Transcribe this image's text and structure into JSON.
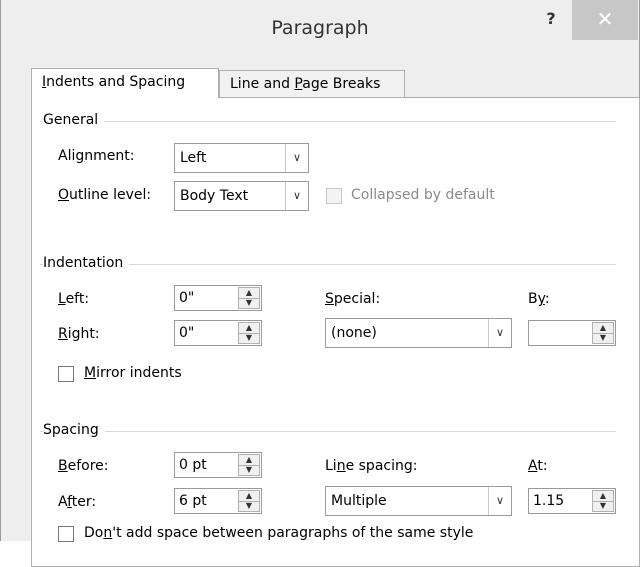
{
  "window": {
    "title": "Paragraph",
    "help_label": "?",
    "close_label": "✕"
  },
  "tabs": [
    {
      "label": "Indents and Spacing",
      "mnemonic": "I",
      "rest": "ndents and Spacing"
    },
    {
      "label": "Line and Page Breaks",
      "pre": "Line and ",
      "mnemonic": "P",
      "rest": "age Breaks"
    }
  ],
  "general": {
    "title": "General",
    "alignment_label": {
      "pre": "Ali",
      "mnemonic": "g",
      "rest": "nment:"
    },
    "alignment_value": "Left",
    "outline_label": {
      "mnemonic": "O",
      "rest": "utline level:"
    },
    "outline_value": "Body Text",
    "collapsed_label": "Collapsed by default"
  },
  "indentation": {
    "title": "Indentation",
    "left_label": {
      "mnemonic": "L",
      "rest": "eft:"
    },
    "left_value": "0\"",
    "right_label": {
      "mnemonic": "R",
      "rest": "ight:"
    },
    "right_value": "0\"",
    "special_label": {
      "mnemonic": "S",
      "rest": "pecial:"
    },
    "special_value": "(none)",
    "by_label": {
      "pre": "B",
      "mnemonic": "y",
      "rest": ":"
    },
    "by_value": "",
    "mirror_label": {
      "mnemonic": "M",
      "rest": "irror indents"
    }
  },
  "spacing": {
    "title": "Spacing",
    "before_label": {
      "mnemonic": "B",
      "rest": "efore:"
    },
    "before_value": "0 pt",
    "after_label": {
      "pre": "A",
      "mnemonic": "f",
      "rest": "ter:"
    },
    "after_value": "6 pt",
    "line_spacing_label": {
      "pre": "Li",
      "mnemonic": "n",
      "rest": "e spacing:"
    },
    "line_spacing_value": "Multiple",
    "at_label": {
      "mnemonic": "A",
      "rest": "t:"
    },
    "at_value": "1.15",
    "dont_add_label": {
      "pre": "Do",
      "mnemonic": "n",
      "rest": "'t add space between paragraphs of the same style"
    }
  },
  "icons": {
    "dropdown": "chevron-down-icon",
    "spin_up": "triangle-up-icon",
    "spin_down": "triangle-down-icon"
  }
}
